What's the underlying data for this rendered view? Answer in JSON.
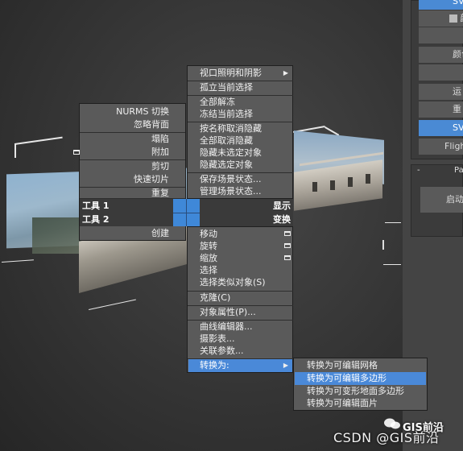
{
  "right_panel": {
    "buttons": [
      "SVS",
      "颜色",
      "",
      "运",
      "重",
      "SVS",
      "Fligh"
    ],
    "rollout_title": "Pa",
    "rollout_collapse": "-",
    "rollout_button": "启动"
  },
  "left_menu": {
    "items": [
      "NURMS 切换",
      "忽略背面",
      "塌陷",
      "附加",
      "剪切",
      "快速切片",
      "重复"
    ],
    "headers": [
      "工具 1",
      "工具 2"
    ],
    "bottom_item": "创建"
  },
  "right_menu": {
    "top_items": [
      "视口照明和阴影",
      "孤立当前选择",
      "全部解冻",
      "冻结当前选择",
      "按名称取消隐藏",
      "全部取消隐藏",
      "隐藏未选定对象",
      "隐藏选定对象",
      "保存场景状态...",
      "管理场景状态..."
    ],
    "headers": [
      "显示",
      "变换"
    ],
    "bottom_items": [
      "移动",
      "旋转",
      "缩放",
      "选择",
      "选择类似对象(S)",
      "克隆(C)",
      "对象属性(P)...",
      "曲线编辑器...",
      "摄影表...",
      "关联参数...",
      "转换为:"
    ]
  },
  "submenu": {
    "items": [
      "转换为可编辑网格",
      "转换为可编辑多边形",
      "转换为可变形地面多边形",
      "转换为可编辑面片"
    ],
    "highlighted_index": 1
  },
  "watermark": {
    "account": "GIS前沿",
    "text": "CSDN @GIS前沿"
  },
  "colors": {
    "highlight": "#4a89d8",
    "menu_bg": "#5a5a5a",
    "header_bg": "#3a3a3a"
  }
}
